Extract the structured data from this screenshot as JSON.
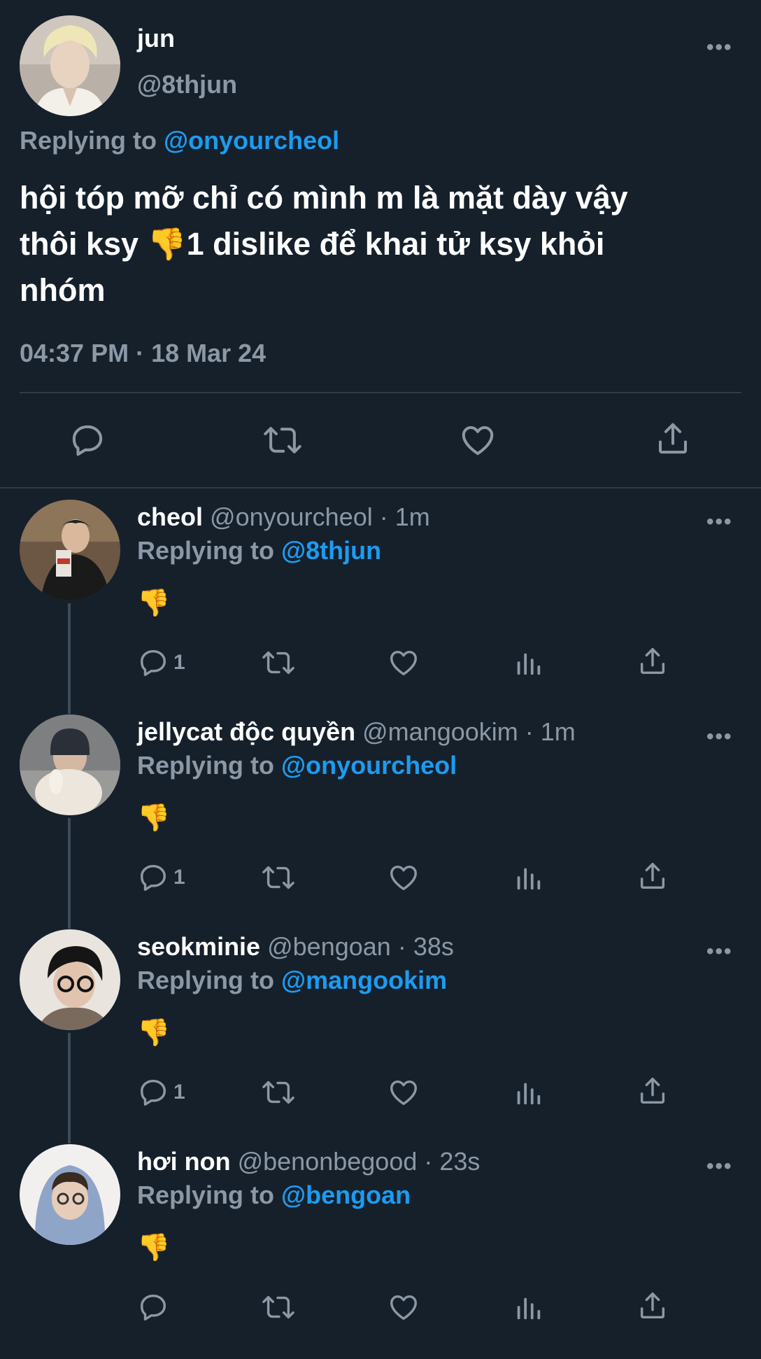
{
  "main_tweet": {
    "display_name": "jun",
    "handle": "@8thjun",
    "replying_prefix": "Replying to",
    "replying_to": "@onyourcheol",
    "text_line1": "hội tóp mỡ chỉ có mình m là mặt dày vậy",
    "text_line2": "thôi ksy 👎1 dislike để khai tử ksy khỏi",
    "text_line3": "nhóm",
    "timestamp": "04:37 PM · 18 Mar 24"
  },
  "replies": [
    {
      "display_name": "cheol",
      "handle": "@onyourcheol",
      "time": "1m",
      "replying_prefix": "Replying to",
      "replying_to": "@8thjun",
      "text": "👎",
      "reply_count": "1"
    },
    {
      "display_name": "jellycat độc quyền",
      "handle": "@mangookim",
      "time": "1m",
      "replying_prefix": "Replying to",
      "replying_to": "@onyourcheol",
      "text": "👎",
      "reply_count": "1"
    },
    {
      "display_name": "seokminie",
      "handle": "@bengoan",
      "time": "38s",
      "replying_prefix": "Replying to",
      "replying_to": "@mangookim",
      "text": "👎",
      "reply_count": "1"
    },
    {
      "display_name": "hơi non",
      "handle": "@benonbegood",
      "time": "23s",
      "replying_prefix": "Replying to",
      "replying_to": "@bengoan",
      "text": "👎",
      "reply_count": ""
    }
  ],
  "meta": {
    "dot": " · ",
    "more": "•••"
  },
  "colors": {
    "background": "#15202b",
    "accent": "#1d9bf0",
    "muted": "#8b98a5",
    "divider": "#2f3c48"
  },
  "icons": [
    "comment-icon",
    "retweet-icon",
    "like-icon",
    "share-icon",
    "views-icon",
    "more-icon"
  ]
}
